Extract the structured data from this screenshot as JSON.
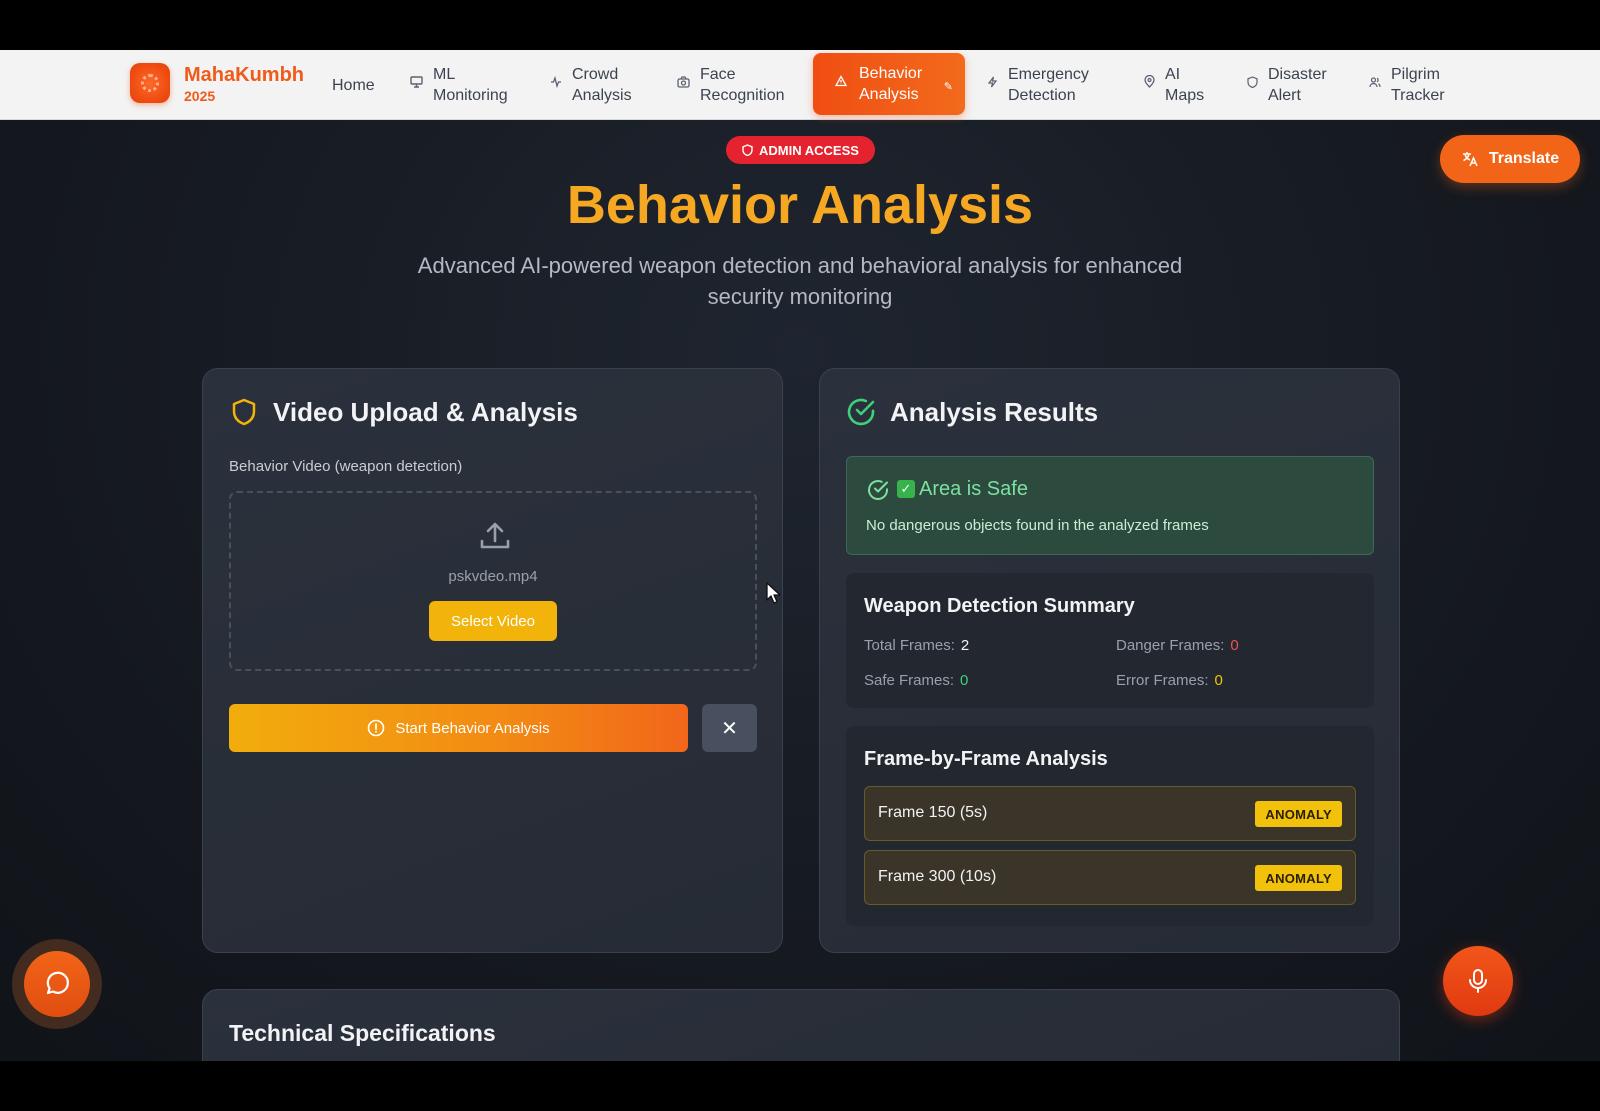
{
  "brand": {
    "name": "MahaKumbh",
    "year": "2025"
  },
  "nav": {
    "items": [
      {
        "label": "Home",
        "icon": ""
      },
      {
        "label": "ML Monitoring",
        "icon": "monitor-icon"
      },
      {
        "label": "Crowd Analysis",
        "icon": "activity-icon"
      },
      {
        "label": "Face Recognition",
        "icon": "camera-icon"
      },
      {
        "label": "Behavior Analysis",
        "icon": "alert-triangle-icon",
        "active": true
      },
      {
        "label": "Emergency Detection",
        "icon": "zap-icon"
      },
      {
        "label": "AI Maps",
        "icon": "map-pin-icon"
      },
      {
        "label": "Disaster Alert",
        "icon": "shield-icon"
      },
      {
        "label": "Pilgrim Tracker",
        "icon": "users-icon"
      }
    ]
  },
  "header": {
    "badge": "ADMIN ACCESS",
    "translate": "Translate",
    "title": "Behavior Analysis",
    "subtitle": "Advanced AI-powered weapon detection and behavioral analysis for enhanced security monitoring"
  },
  "upload_card": {
    "title": "Video Upload & Analysis",
    "field_label": "Behavior Video (weapon detection)",
    "file_name": "pskvdeo.mp4",
    "select_button": "Select Video",
    "start_button": "Start Behavior Analysis",
    "clear_button": "✕"
  },
  "results_card": {
    "title": "Analysis Results",
    "status_title": "Area is Safe",
    "status_message": "No dangerous objects found in the analyzed frames",
    "summary_title": "Weapon Detection Summary",
    "stats": {
      "total_label": "Total Frames:",
      "total_value": "2",
      "danger_label": "Danger Frames:",
      "danger_value": "0",
      "safe_label": "Safe Frames:",
      "safe_value": "0",
      "error_label": "Error Frames:",
      "error_value": "0"
    },
    "frames_title": "Frame-by-Frame Analysis",
    "frames": [
      {
        "label": "Frame 150 (5s)",
        "tag": "ANOMALY"
      },
      {
        "label": "Frame 300 (10s)",
        "tag": "ANOMALY"
      }
    ]
  },
  "tech": {
    "title": "Technical Specifications"
  },
  "colors": {
    "accent": "#f26418",
    "title": "#f7a823",
    "safe": "#7ee0a0",
    "danger": "#f05252",
    "badge": "#e5232f"
  }
}
